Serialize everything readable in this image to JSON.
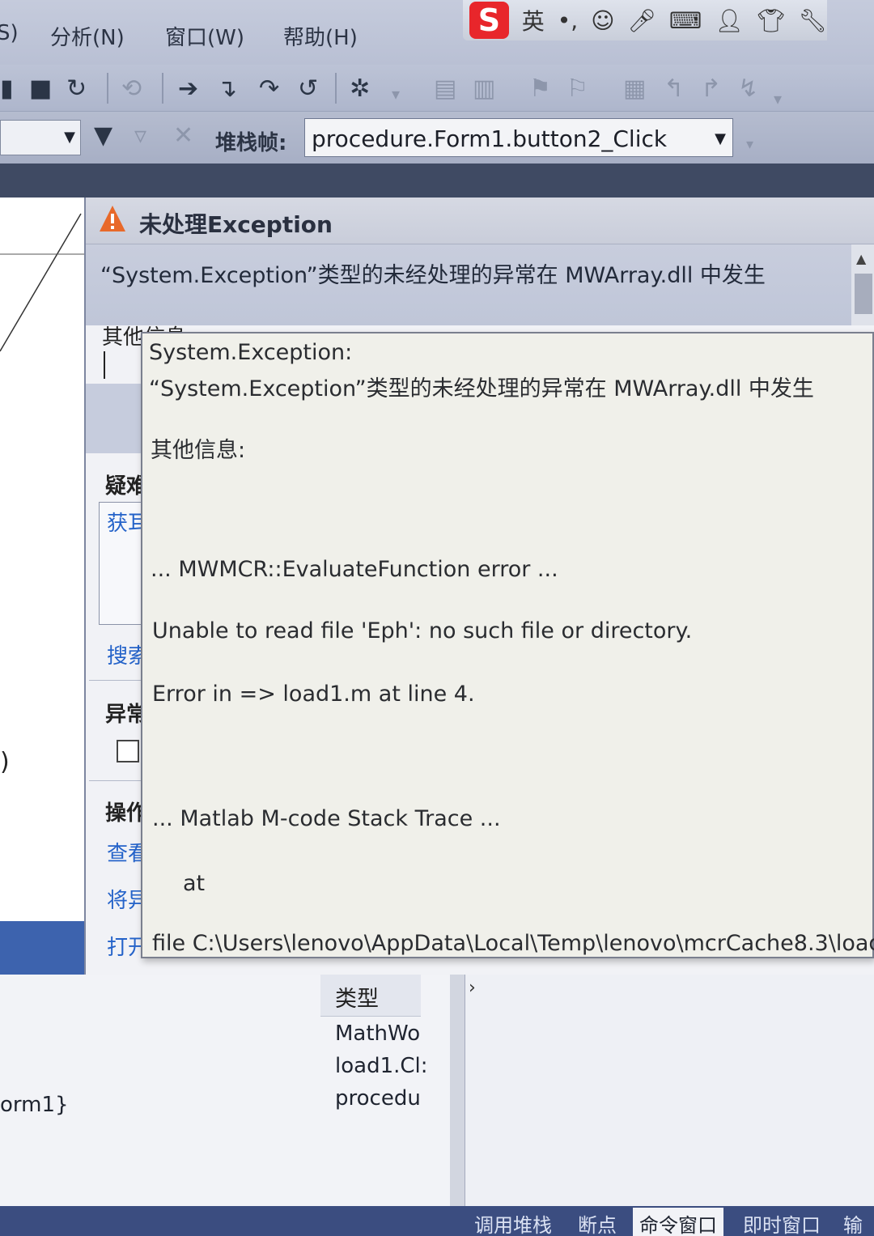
{
  "menubar": {
    "items": [
      "S)",
      "分析(N)",
      "窗口(W)",
      "帮助(H)"
    ]
  },
  "ime": {
    "logo": "S",
    "mode": "英"
  },
  "toolbar2": {
    "stack_label": "堆栈帧:",
    "stack_frame": "procedure.Form1.button2_Click"
  },
  "exception": {
    "title": "未处理Exception",
    "message": "“System.Exception”类型的未经处理的异常在 MWArray.dll 中发生",
    "other_info_label": "其他信息",
    "sections": {
      "troubleshoot": "疑难",
      "get_help": "获耳",
      "search": "搜索",
      "exception_settings": "异常",
      "actions": "操作",
      "view": "查看",
      "copy": "将异",
      "open": "打开"
    }
  },
  "popup": {
    "lines": [
      "System.Exception:",
      "“System.Exception”类型的未经处理的异常在 MWArray.dll 中发生",
      "其他信息:",
      "... MWMCR::EvaluateFunction error ...",
      "Unable to read file 'Eph': no such file or directory.",
      "Error in => load1.m at line 4.",
      "... Matlab M-code Stack Trace ...",
      "at",
      "file C:\\Users\\lenovo\\AppData\\Local\\Temp\\lenovo\\mcrCache8.3\\load"
    ]
  },
  "callstack": {
    "type_header": "类型",
    "type_cells": [
      "MathWo",
      "load1.Cl:",
      "procedu"
    ],
    "name_fragment": "orm1}"
  },
  "editor": {
    "fold_glyph": ")"
  },
  "tabs": [
    "调用堆栈",
    "断点",
    "命令窗口",
    "即时窗口",
    "输出"
  ]
}
